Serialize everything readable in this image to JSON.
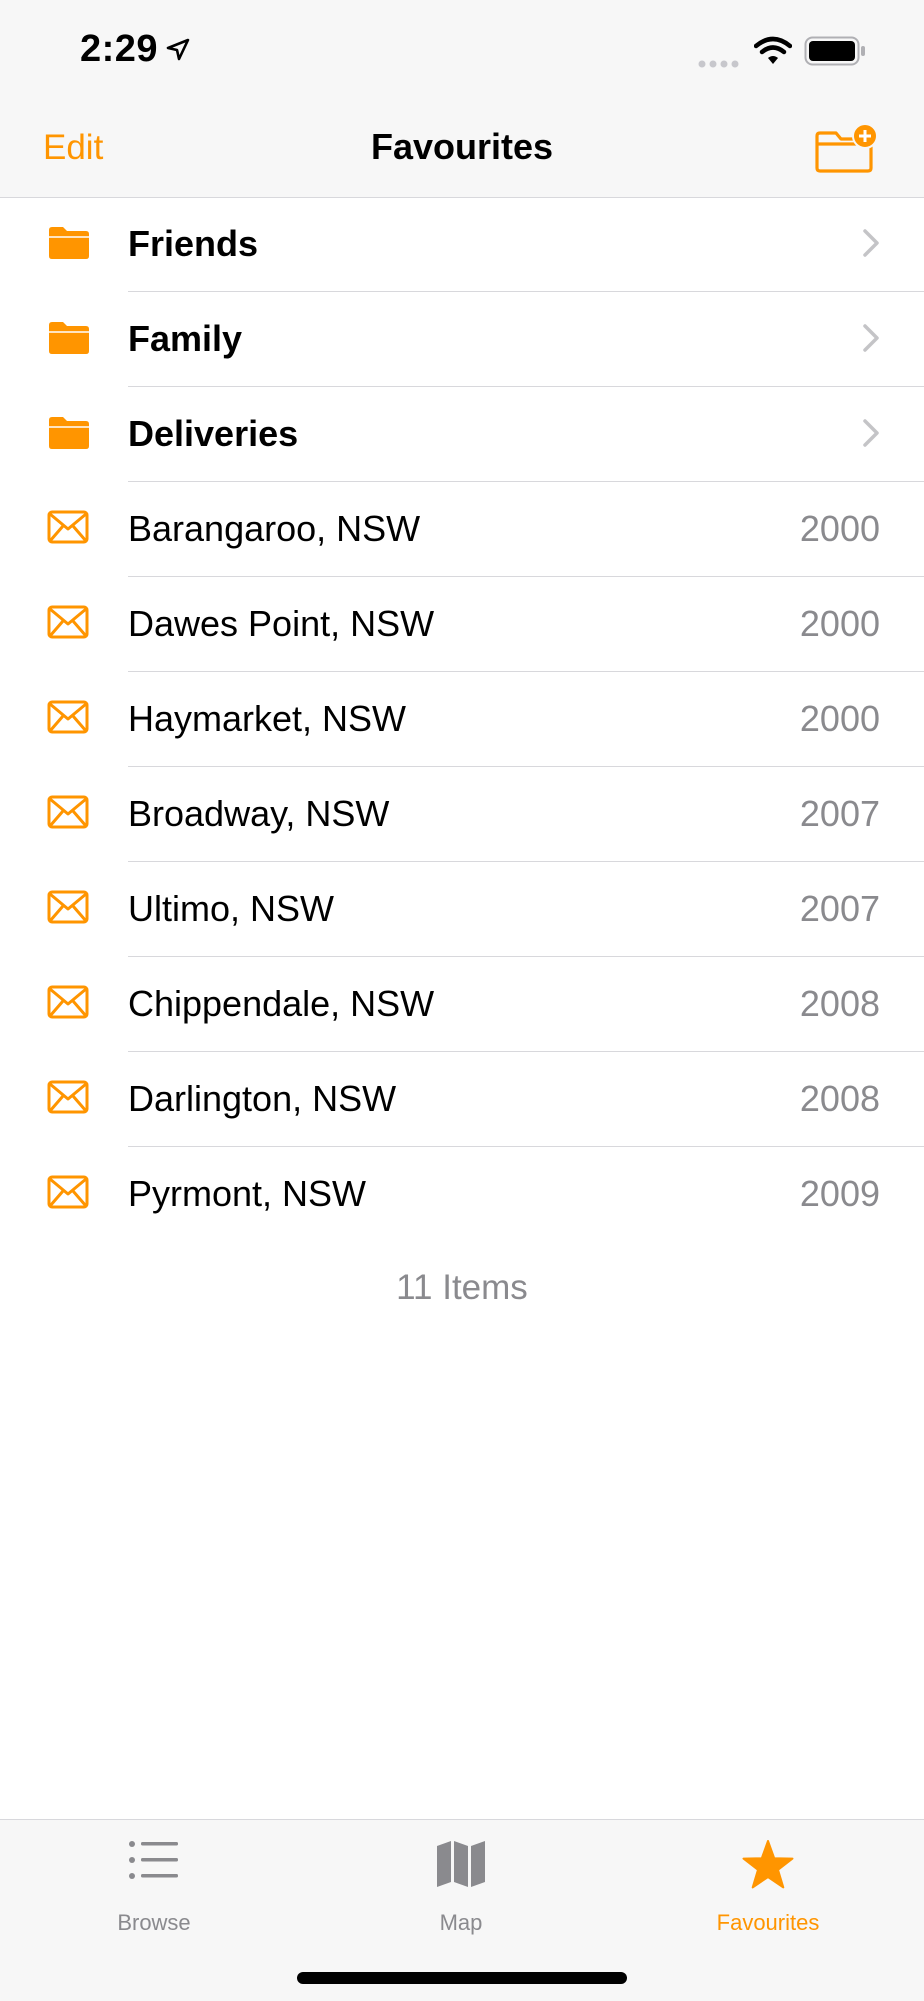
{
  "status_bar": {
    "time": "2:29"
  },
  "nav": {
    "edit_label": "Edit",
    "title": "Favourites"
  },
  "folders": [
    {
      "label": "Friends",
      "icon": "folder-icon"
    },
    {
      "label": "Family",
      "icon": "folder-icon"
    },
    {
      "label": "Deliveries",
      "icon": "folder-icon"
    }
  ],
  "places": [
    {
      "label": "Barangaroo, NSW",
      "postcode": "2000",
      "icon": "envelope-icon"
    },
    {
      "label": "Dawes Point, NSW",
      "postcode": "2000",
      "icon": "envelope-icon"
    },
    {
      "label": "Haymarket, NSW",
      "postcode": "2000",
      "icon": "envelope-icon"
    },
    {
      "label": "Broadway, NSW",
      "postcode": "2007",
      "icon": "envelope-icon"
    },
    {
      "label": "Ultimo, NSW",
      "postcode": "2007",
      "icon": "envelope-icon"
    },
    {
      "label": "Chippendale, NSW",
      "postcode": "2008",
      "icon": "envelope-icon"
    },
    {
      "label": "Darlington, NSW",
      "postcode": "2008",
      "icon": "envelope-icon"
    },
    {
      "label": "Pyrmont, NSW",
      "postcode": "2009",
      "icon": "envelope-icon"
    }
  ],
  "footer": {
    "items_count": "11 Items"
  },
  "tabs": [
    {
      "label": "Browse",
      "icon": "list-icon",
      "selected": false
    },
    {
      "label": "Map",
      "icon": "map-icon",
      "selected": false
    },
    {
      "label": "Favourites",
      "icon": "star-icon",
      "selected": true
    }
  ],
  "colors": {
    "accent": "#ff9500",
    "secondary_text": "#8a8a8e",
    "separator": "#d8d8dc",
    "bar_background": "#f7f7f7"
  }
}
